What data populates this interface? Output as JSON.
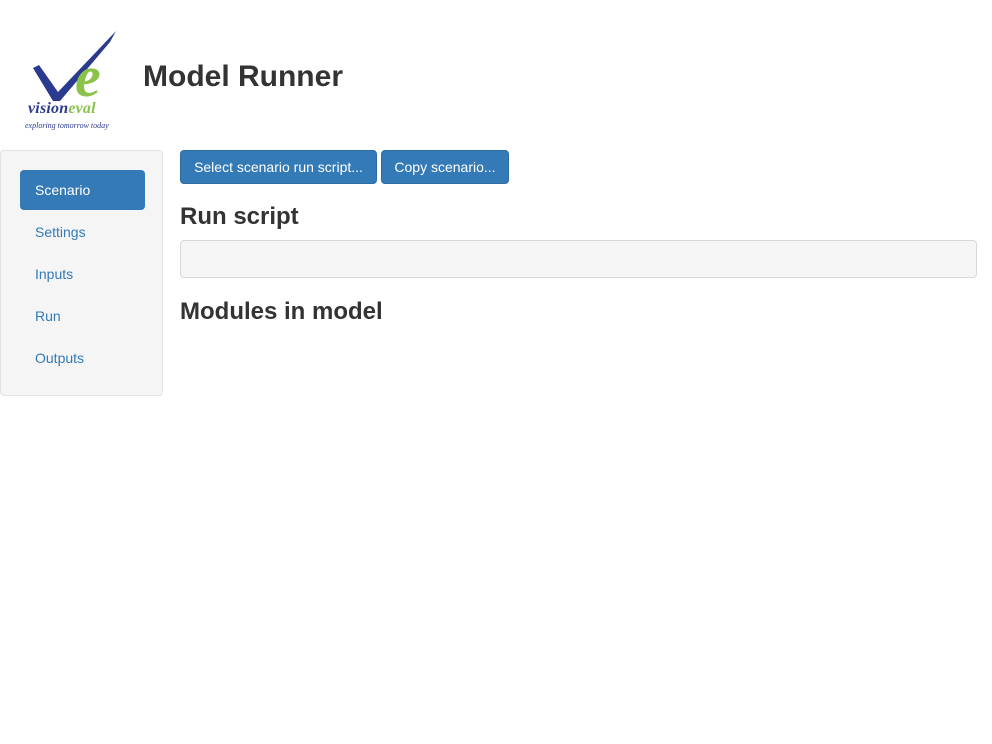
{
  "header": {
    "title": "Model Runner",
    "logo": {
      "wordmark_part1": "vision",
      "wordmark_part2": "eval",
      "tagline": "exploring tomorrow today",
      "colors": {
        "navy": "#2a3a8f",
        "green": "#8bc34a"
      }
    }
  },
  "sidebar": {
    "items": [
      {
        "label": "Scenario",
        "active": true
      },
      {
        "label": "Settings",
        "active": false
      },
      {
        "label": "Inputs",
        "active": false
      },
      {
        "label": "Run",
        "active": false
      },
      {
        "label": "Outputs",
        "active": false
      }
    ]
  },
  "toolbar": {
    "select_label": "Select scenario run script...",
    "copy_label": "Copy scenario..."
  },
  "main": {
    "run_script_heading": "Run script",
    "run_script_value": "",
    "modules_heading": "Modules in model"
  },
  "colors": {
    "primary": "#337ab7",
    "well_background": "#f5f5f5",
    "text": "#333333"
  }
}
